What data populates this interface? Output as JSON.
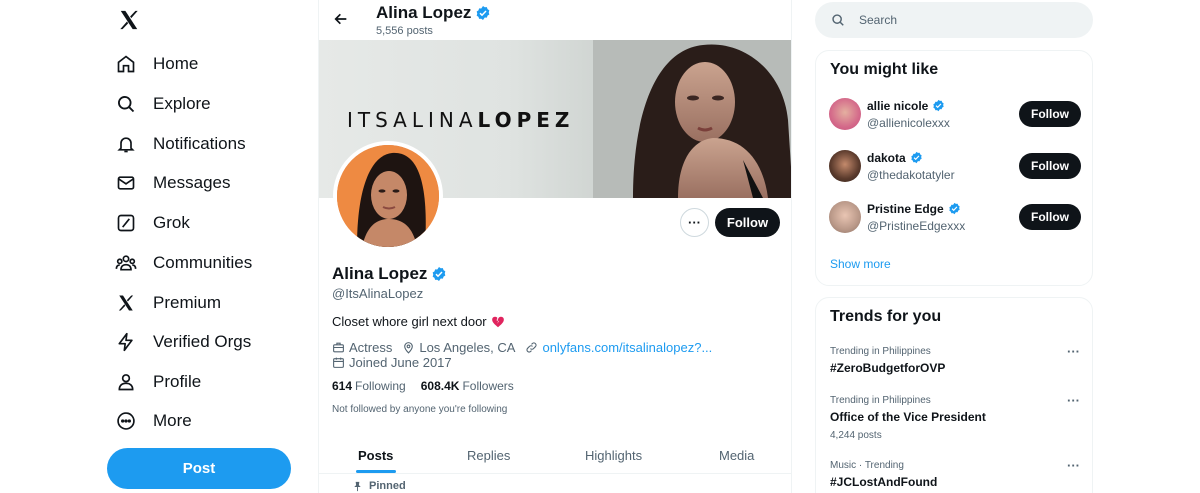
{
  "nav": {
    "items": [
      {
        "label": "Home",
        "icon": "home-icon"
      },
      {
        "label": "Explore",
        "icon": "search-icon"
      },
      {
        "label": "Notifications",
        "icon": "bell-icon"
      },
      {
        "label": "Messages",
        "icon": "envelope-icon"
      },
      {
        "label": "Grok",
        "icon": "grok-icon"
      },
      {
        "label": "Communities",
        "icon": "people-icon"
      },
      {
        "label": "Premium",
        "icon": "x-logo-icon"
      },
      {
        "label": "Verified Orgs",
        "icon": "lightning-icon"
      },
      {
        "label": "Profile",
        "icon": "person-icon"
      },
      {
        "label": "More",
        "icon": "more-circle-icon"
      }
    ],
    "post_label": "Post"
  },
  "header": {
    "name": "Alina Lopez",
    "posts": "5,556 posts"
  },
  "banner": {
    "text_light": "ITSALINA",
    "text_bold": "LOPEZ"
  },
  "profile": {
    "more_label": "···",
    "follow_label": "Follow",
    "name": "Alina Lopez",
    "handle": "@ItsAlinaLopez",
    "bio": "Closet whore girl next door",
    "occupation": "Actress",
    "location": "Los Angeles, CA",
    "link": "onlyfans.com/itsalinalopez?...",
    "joined": "Joined June 2017",
    "following_count": "614",
    "following_label": "Following",
    "followers_count": "608.4K",
    "followers_label": "Followers",
    "not_followed": "Not followed by anyone you're following"
  },
  "tabs": [
    "Posts",
    "Replies",
    "Highlights",
    "Media"
  ],
  "pinned_label": "Pinned",
  "search": {
    "placeholder": "Search"
  },
  "you_might_like": {
    "title": "You might like",
    "users": [
      {
        "name": "allie nicole",
        "handle": "@allienicolexxx",
        "follow": "Follow"
      },
      {
        "name": "dakota",
        "handle": "@thedakotatyler",
        "follow": "Follow"
      },
      {
        "name": "Pristine Edge",
        "handle": "@PristineEdgexxx",
        "follow": "Follow"
      }
    ],
    "show_more": "Show more"
  },
  "trends": {
    "title": "Trends for you",
    "items": [
      {
        "context": "Trending in Philippines",
        "name": "#ZeroBudgetforOVP",
        "count": ""
      },
      {
        "context": "Trending in Philippines",
        "name": "Office of the Vice President",
        "count": "4,244 posts"
      },
      {
        "context": "Music · Trending",
        "name": "#JCLostAndFound",
        "count": ""
      }
    ],
    "more_label": "···"
  },
  "colors": {
    "accent": "#1d9bf0",
    "text": "#0f1419",
    "muted": "#536471",
    "avatar_orange": "#f08a3c"
  }
}
